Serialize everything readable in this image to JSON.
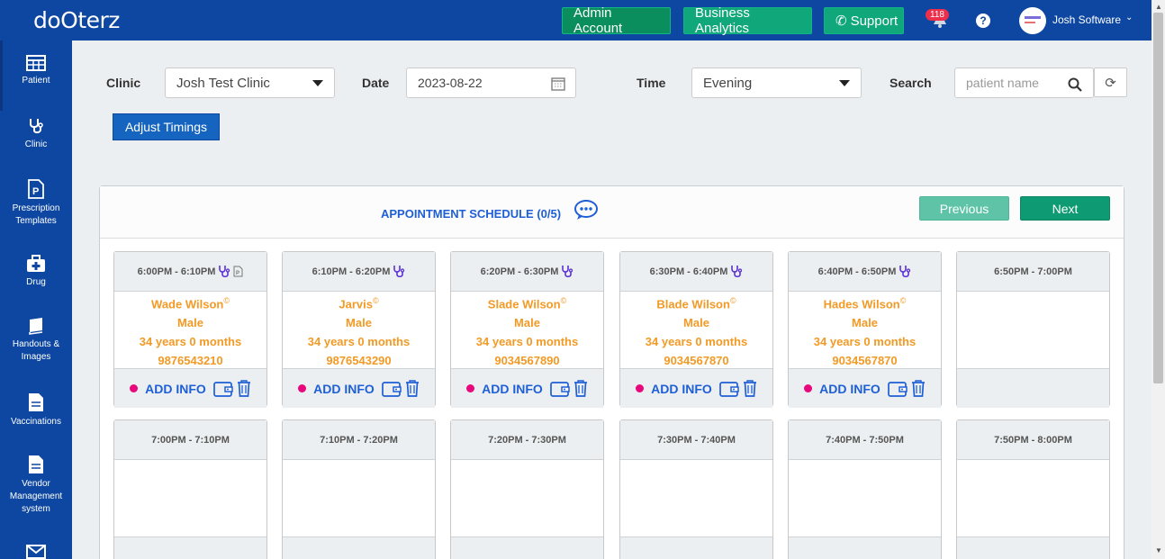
{
  "app": {
    "logo": "doOterz"
  },
  "topbar": {
    "admin_label": "Admin Account",
    "analytics_label": "Business Analytics",
    "support_label": "Support",
    "notifications_count": "118",
    "help_label": "?",
    "user_name": "Josh Software"
  },
  "sidebar": {
    "items": [
      {
        "label": "Patient",
        "icon": "table-icon"
      },
      {
        "label": "Clinic",
        "icon": "stethoscope-icon"
      },
      {
        "label": "Prescription Templates",
        "icon": "prescription-icon"
      },
      {
        "label": "Drug",
        "icon": "medkit-icon"
      },
      {
        "label": "Handouts & Images",
        "icon": "book-icon"
      },
      {
        "label": "Vaccinations",
        "icon": "document-icon"
      },
      {
        "label": "Vendor Management system",
        "icon": "document-icon"
      }
    ]
  },
  "filters": {
    "clinic_label": "Clinic",
    "clinic_value": "Josh Test Clinic",
    "date_label": "Date",
    "date_value": "2023-08-22",
    "time_label": "Time",
    "time_value": "Evening",
    "search_label": "Search",
    "search_placeholder": "patient name",
    "adjust_label": "Adjust Timings"
  },
  "schedule": {
    "title": "APPOINTMENT SCHEDULE (0/5)",
    "prev_label": "Previous",
    "next_label": "Next",
    "add_info_label": "ADD INFO",
    "slots": [
      {
        "time": "6:00PM - 6:10PM",
        "name": "Wade Wilson",
        "gender": "Male",
        "age": "34 years 0 months",
        "phone": "9876543210",
        "doc": true
      },
      {
        "time": "6:10PM - 6:20PM",
        "name": "Jarvis",
        "gender": "Male",
        "age": "34 years 0 months",
        "phone": "9876543290"
      },
      {
        "time": "6:20PM - 6:30PM",
        "name": "Slade Wilson",
        "gender": "Male",
        "age": "34 years 0 months",
        "phone": "9034567890"
      },
      {
        "time": "6:30PM - 6:40PM",
        "name": "Blade Wilson",
        "gender": "Male",
        "age": "34 years 0 months",
        "phone": "9034567870"
      },
      {
        "time": "6:40PM - 6:50PM",
        "name": "Hades Wilson",
        "gender": "Male",
        "age": "34 years 0 months",
        "phone": "9034567870"
      },
      {
        "time": "6:50PM - 7:00PM"
      },
      {
        "time": "7:00PM - 7:10PM"
      },
      {
        "time": "7:10PM - 7:20PM"
      },
      {
        "time": "7:20PM - 7:30PM"
      },
      {
        "time": "7:30PM - 7:40PM"
      },
      {
        "time": "7:40PM - 7:50PM"
      },
      {
        "time": "7:50PM - 8:00PM"
      }
    ]
  }
}
